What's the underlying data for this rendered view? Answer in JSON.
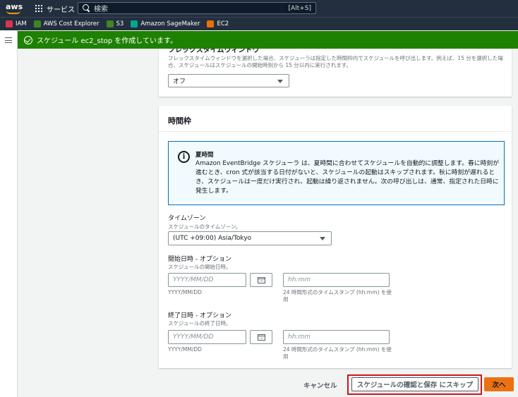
{
  "topnav": {
    "logo": "aws",
    "services_label": "サービス",
    "search_placeholder": "検索",
    "search_shortcut": "[Alt+S]"
  },
  "favorites": [
    {
      "label": "IAM",
      "color": "#dd344c"
    },
    {
      "label": "AWS Cost Explorer",
      "color": "#3f8624"
    },
    {
      "label": "S3",
      "color": "#3f8624"
    },
    {
      "label": "Amazon SageMaker",
      "color": "#01a88d"
    },
    {
      "label": "EC2",
      "color": "#ed7100"
    }
  ],
  "flash": {
    "message": "スケジュール ec2_stop を作成しています。"
  },
  "flexible_window": {
    "title": "フレックスタイムウィンドウ",
    "description": "フレックスタイムウィンドウを選択した場合、スケジューラは指定した時間枠内でスケジュールを呼び出します。例えば、15 分を選択した場合、スケジュールはスケジュールの開始時刻から 15 分以内に実行されます。",
    "value": "オフ"
  },
  "timeframe": {
    "title": "時間枠",
    "info": {
      "heading": "夏時間",
      "body": "Amazon EventBridge スケジューラ は、夏時間に合わせてスケジュールを自動的に調整します。春に時刻が進むとき、cron 式が該当する日付がないと、スケジュールの起動はスキップされます。秋に時刻が遅れるとき、スケジュールは一度だけ実行され、起動は繰り返されません。次の呼び出しは、通常、指定された日時に発生します。"
    },
    "timezone": {
      "label": "タイムゾーン",
      "description": "スケジュールのタイムゾーン。",
      "value": "(UTC +09:00) Asia/Tokyo"
    },
    "start": {
      "label": "開始日時 - オプション",
      "description": "スケジュールの開始日時。",
      "date_placeholder": "YYYY/MM/DD",
      "date_hint": "YYYY/MM/DD",
      "time_placeholder": "hh:mm",
      "time_hint": "24 時間形式のタイムスタンプ (hh:mm) を使用"
    },
    "end": {
      "label": "終了日時 - オプション",
      "description": "スケジュールの終了日時。",
      "date_placeholder": "YYYY/MM/DD",
      "date_hint": "YYYY/MM/DD",
      "time_placeholder": "hh:mm",
      "time_hint": "24 時間形式のタイムスタンプ (hh:mm) を使用"
    }
  },
  "footer": {
    "cancel_label": "キャンセル",
    "skip_label": "スケジュールの確認と保存 にスキップ",
    "next_label": "次へ"
  }
}
